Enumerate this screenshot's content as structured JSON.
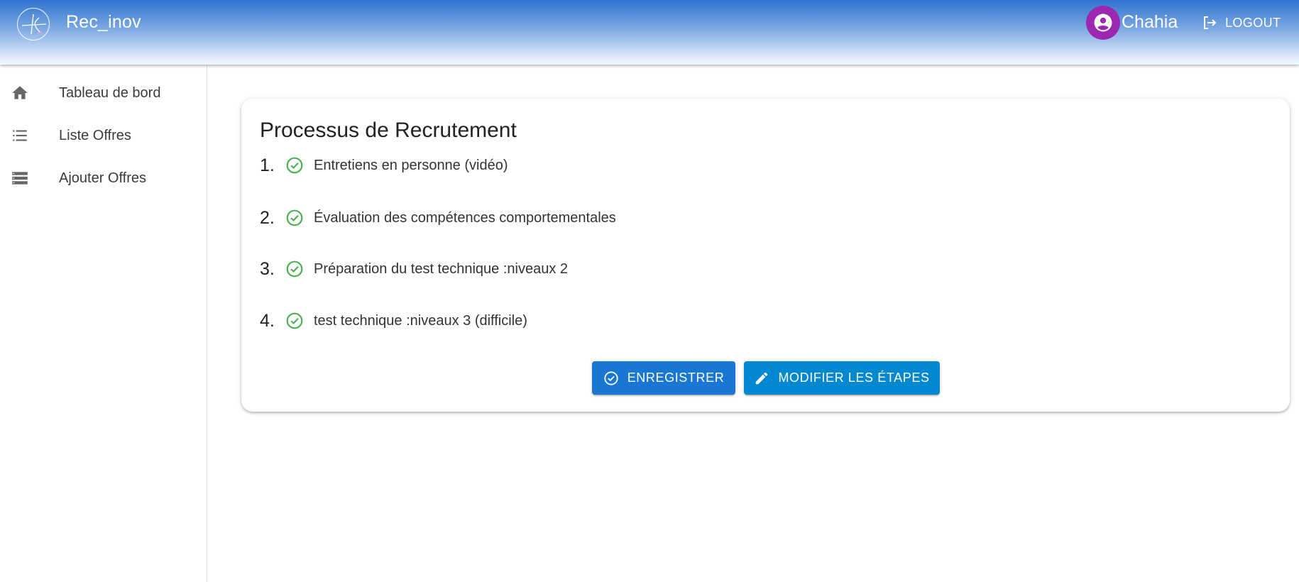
{
  "header": {
    "app_title": "Rec_inov",
    "user_name": "Chahia",
    "logout_label": "LOGOUT"
  },
  "sidebar": {
    "items": [
      {
        "label": "Tableau de bord",
        "icon": "home-icon"
      },
      {
        "label": "Liste Offres",
        "icon": "list-icon"
      },
      {
        "label": "Ajouter Offres",
        "icon": "storage-icon"
      }
    ]
  },
  "card": {
    "title": "Processus de Recrutement",
    "steps": [
      {
        "number": "1.",
        "text": "Entretiens en personne (vidéo)"
      },
      {
        "number": "2.",
        "text": "Évaluation des compétences comportementales"
      },
      {
        "number": "3.",
        "text": "Préparation du test technique :niveaux 2"
      },
      {
        "number": "4.",
        "text": "test technique :niveaux 3 (difficile)"
      }
    ],
    "save_label": "ENREGISTRER",
    "edit_label": "MODIFIER LES ÉTAPES"
  },
  "colors": {
    "primary": "#1976d2",
    "secondary_button": "#0288d1",
    "avatar": "#9c27b0",
    "success": "#4caf50"
  }
}
